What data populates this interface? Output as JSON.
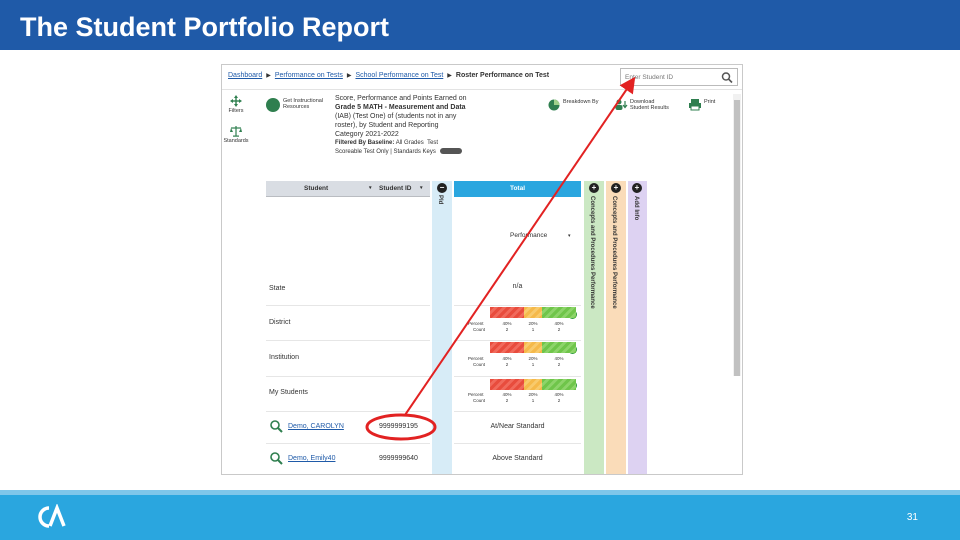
{
  "slide": {
    "title": "The Student Portfolio Report",
    "page_number": "31",
    "colors": {
      "title_bar": "#1f5aa8",
      "footer": "#2aa6df",
      "annotation": "#e22222"
    }
  },
  "screenshot": {
    "breadcrumb": [
      "Dashboard",
      "Performance on Tests",
      "School Performance on Test",
      "Roster Performance on Test"
    ],
    "search_placeholder": "Enter Student ID",
    "left_buttons": [
      {
        "label": "Filters",
        "icon": "move-arrows-icon"
      },
      {
        "label": "Standards",
        "icon": "scales-icon"
      }
    ],
    "instructional_resources_label": "Get Instructional Resources",
    "description": {
      "line1": "Score, Performance and Points Earned on",
      "line2": "Grade 5 MATH - Measurement and Data",
      "line3": "(IAB) (Test One) of (students not in any",
      "line4": "roster), by Student and Reporting",
      "line5": "Category 2021-2022",
      "filtered_by_label": "Filtered By Baseline:",
      "filtered_by_value": "All Grades",
      "filtered_extra": "Test",
      "status": "Scoreable Test Only",
      "standards_keys": "Standards Keys"
    },
    "toolbar": {
      "breakdown": "Breakdown By",
      "download": "Download Student Results",
      "print": "Print"
    },
    "table": {
      "headers": {
        "student": "Student",
        "student_id": "Student ID",
        "total": "Total"
      },
      "collapsed_column": "Pld",
      "performance_label": "Performance",
      "rows": [
        "State",
        "District",
        "Institution",
        "My Students"
      ],
      "state_value": "n/a",
      "distribution_labels": {
        "percent": "Percent",
        "count": "Count"
      },
      "distributions": [
        {
          "percents": [
            "40%",
            "20%",
            "40%"
          ],
          "counts": [
            "2",
            "1",
            "2"
          ]
        },
        {
          "percents": [
            "40%",
            "20%",
            "40%"
          ],
          "counts": [
            "2",
            "1",
            "2"
          ]
        },
        {
          "percents": [
            "40%",
            "20%",
            "40%"
          ],
          "counts": [
            "2",
            "1",
            "2"
          ]
        }
      ],
      "students": [
        {
          "name": "Demo, CAROLYN",
          "id": "9999999195",
          "performance": "At/Near Standard"
        },
        {
          "name": "Demo, Emily40",
          "id": "9999999640",
          "performance": "Above Standard"
        }
      ],
      "reporting_columns": [
        "Concepts and Procedures Performance",
        "Concepts and Procedures Performance",
        "Add Info"
      ]
    }
  }
}
